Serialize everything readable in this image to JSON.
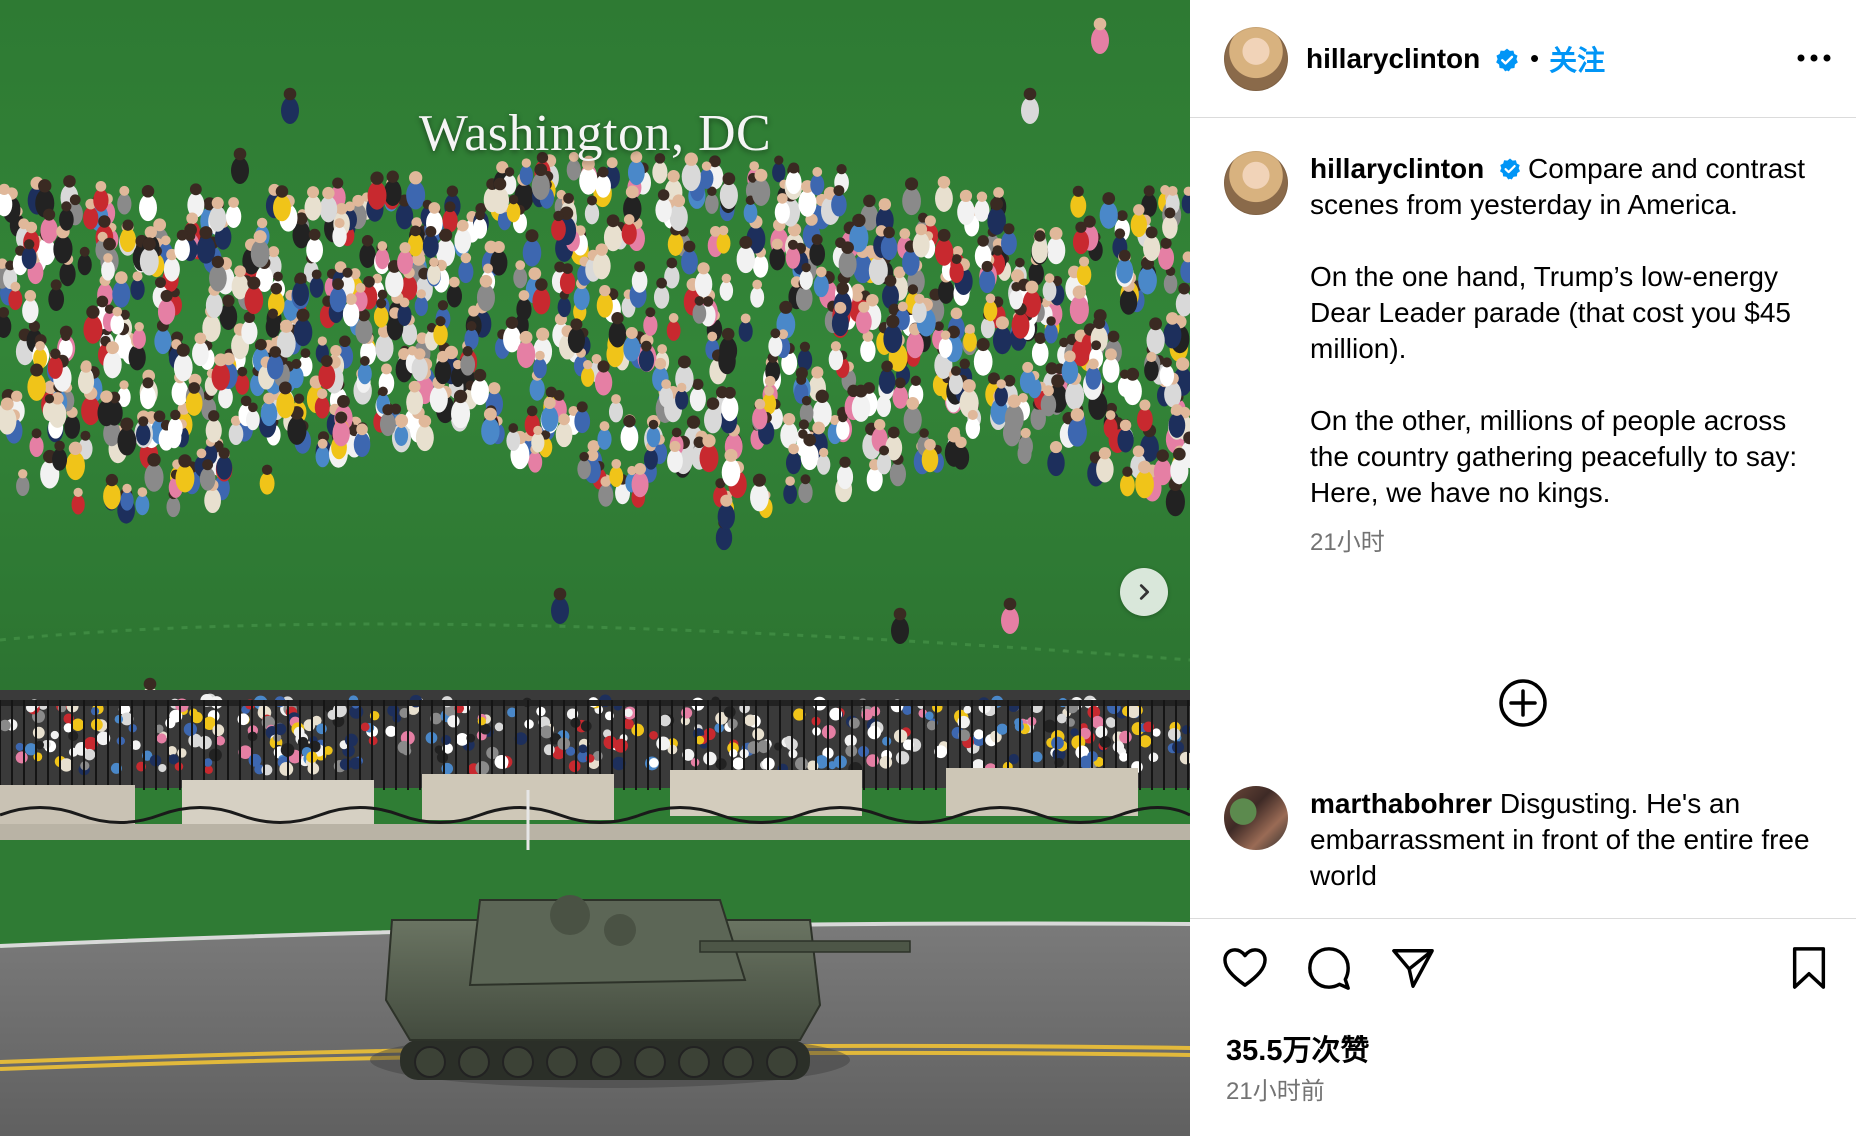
{
  "media": {
    "caption_overlay": "Washington, DC",
    "next_button_icon": "chevron-right-icon",
    "scene_description_icon": "photo"
  },
  "post_header": {
    "username": "hillaryclinton",
    "verified_icon": "verified-badge-icon",
    "separator": "•",
    "follow_label": "关注",
    "more_icon": "more-horizontal-icon"
  },
  "caption": {
    "username": "hillaryclinton",
    "text": "Compare and contrast scenes from yesterday in America.\n\nOn the one hand, Trump’s low-energy Dear Leader parade (that cost you $45 million).\n\nOn the other, millions of people across the country gathering peacefully to say: Here, we have no kings.",
    "time": "21小时"
  },
  "load_more_icon": "plus-circle-icon",
  "comments": [
    {
      "username": "marthabohrer",
      "text": "Disgusting. He's an embarrassment in front of the entire free world"
    }
  ],
  "actions": {
    "like_icon": "heart-icon",
    "comment_icon": "comment-icon",
    "share_icon": "send-icon",
    "save_icon": "bookmark-icon",
    "likes": "35.5万次赞",
    "posted_ago": "21小时前"
  },
  "colors": {
    "accent": "#0095f6",
    "verified": "#0095f6",
    "muted": "#737373",
    "divider": "#dbdbdb",
    "grass": "#2f7d34",
    "road": "#6f6f6f"
  }
}
